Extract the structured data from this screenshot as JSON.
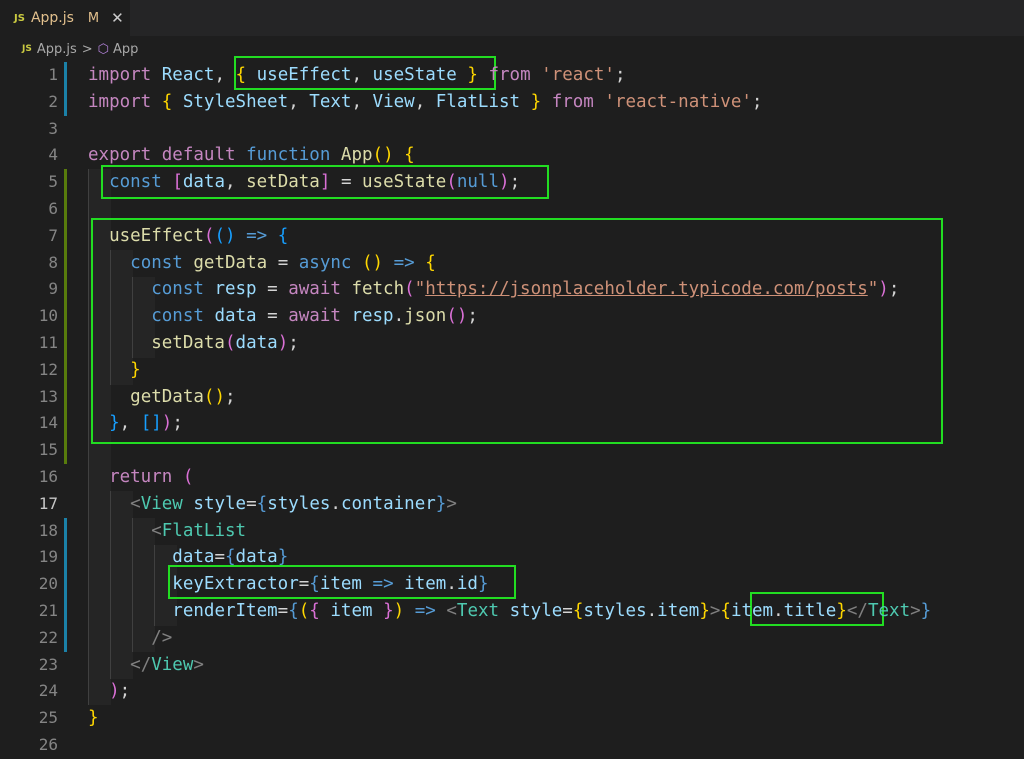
{
  "tab": {
    "icon": "JS",
    "name": "App.js",
    "modified": "M",
    "close": "✕"
  },
  "breadcrumb": {
    "icon": "JS",
    "file": "App.js",
    "separator": ">",
    "symbol": "App"
  },
  "lines": [
    {
      "n": "1",
      "t": [
        [
          "kw",
          "import"
        ],
        [
          "op",
          " "
        ],
        [
          "vr",
          "React"
        ],
        [
          "op",
          ", "
        ],
        [
          "b1",
          "{"
        ],
        [
          "op",
          " "
        ],
        [
          "vr",
          "useEffect"
        ],
        [
          "op",
          ", "
        ],
        [
          "vr",
          "useState"
        ],
        [
          "op",
          " "
        ],
        [
          "b1",
          "}"
        ],
        [
          "op",
          " "
        ],
        [
          "kw",
          "from"
        ],
        [
          "op",
          " "
        ],
        [
          "s",
          "'react'"
        ],
        [
          "op",
          ";"
        ]
      ]
    },
    {
      "n": "2",
      "t": [
        [
          "kw",
          "import"
        ],
        [
          "op",
          " "
        ],
        [
          "b1",
          "{"
        ],
        [
          "op",
          " "
        ],
        [
          "vr",
          "StyleSheet"
        ],
        [
          "op",
          ", "
        ],
        [
          "vr",
          "Text"
        ],
        [
          "op",
          ", "
        ],
        [
          "vr",
          "View"
        ],
        [
          "op",
          ", "
        ],
        [
          "vr",
          "FlatList"
        ],
        [
          "op",
          " "
        ],
        [
          "b1",
          "}"
        ],
        [
          "op",
          " "
        ],
        [
          "kw",
          "from"
        ],
        [
          "op",
          " "
        ],
        [
          "s",
          "'react-native'"
        ],
        [
          "op",
          ";"
        ]
      ]
    },
    {
      "n": "3",
      "t": []
    },
    {
      "n": "4",
      "t": [
        [
          "kw",
          "export"
        ],
        [
          "op",
          " "
        ],
        [
          "kw",
          "default"
        ],
        [
          "op",
          " "
        ],
        [
          "st",
          "function"
        ],
        [
          "op",
          " "
        ],
        [
          "fn",
          "App"
        ],
        [
          "b1",
          "()"
        ],
        [
          "op",
          " "
        ],
        [
          "b1",
          "{"
        ]
      ]
    },
    {
      "n": "5",
      "t": [
        [
          "op",
          "  "
        ],
        [
          "st",
          "const"
        ],
        [
          "op",
          " "
        ],
        [
          "b2",
          "["
        ],
        [
          "vr",
          "data"
        ],
        [
          "op",
          ", "
        ],
        [
          "fn",
          "setData"
        ],
        [
          "b2",
          "]"
        ],
        [
          "op",
          " = "
        ],
        [
          "fn",
          "useState"
        ],
        [
          "b2",
          "("
        ],
        [
          "st",
          "null"
        ],
        [
          "b2",
          ")"
        ],
        [
          "op",
          ";"
        ]
      ]
    },
    {
      "n": "6",
      "t": []
    },
    {
      "n": "7",
      "t": [
        [
          "op",
          "  "
        ],
        [
          "fn",
          "useEffect"
        ],
        [
          "b2",
          "("
        ],
        [
          "b3",
          "()"
        ],
        [
          "op",
          " "
        ],
        [
          "st",
          "=>"
        ],
        [
          "op",
          " "
        ],
        [
          "b3",
          "{"
        ]
      ]
    },
    {
      "n": "8",
      "t": [
        [
          "op",
          "    "
        ],
        [
          "st",
          "const"
        ],
        [
          "op",
          " "
        ],
        [
          "fn",
          "getData"
        ],
        [
          "op",
          " = "
        ],
        [
          "st",
          "async"
        ],
        [
          "op",
          " "
        ],
        [
          "b1",
          "()"
        ],
        [
          "op",
          " "
        ],
        [
          "st",
          "=>"
        ],
        [
          "op",
          " "
        ],
        [
          "b1",
          "{"
        ]
      ]
    },
    {
      "n": "9",
      "t": [
        [
          "op",
          "      "
        ],
        [
          "st",
          "const"
        ],
        [
          "op",
          " "
        ],
        [
          "vr",
          "resp"
        ],
        [
          "op",
          " = "
        ],
        [
          "kw",
          "await"
        ],
        [
          "op",
          " "
        ],
        [
          "fn",
          "fetch"
        ],
        [
          "b2",
          "("
        ],
        [
          "s",
          "\""
        ],
        [
          "url",
          "https://jsonplaceholder.typicode.com/posts"
        ],
        [
          "s",
          "\""
        ],
        [
          "b2",
          ")"
        ],
        [
          "op",
          ";"
        ]
      ]
    },
    {
      "n": "10",
      "t": [
        [
          "op",
          "      "
        ],
        [
          "st",
          "const"
        ],
        [
          "op",
          " "
        ],
        [
          "vr",
          "data"
        ],
        [
          "op",
          " = "
        ],
        [
          "kw",
          "await"
        ],
        [
          "op",
          " "
        ],
        [
          "vr",
          "resp"
        ],
        [
          "op",
          "."
        ],
        [
          "fn",
          "json"
        ],
        [
          "b2",
          "()"
        ],
        [
          "op",
          ";"
        ]
      ]
    },
    {
      "n": "11",
      "t": [
        [
          "op",
          "      "
        ],
        [
          "fn",
          "setData"
        ],
        [
          "b2",
          "("
        ],
        [
          "vr",
          "data"
        ],
        [
          "b2",
          ")"
        ],
        [
          "op",
          ";"
        ]
      ]
    },
    {
      "n": "12",
      "t": [
        [
          "op",
          "    "
        ],
        [
          "b1",
          "}"
        ]
      ]
    },
    {
      "n": "13",
      "t": [
        [
          "op",
          "    "
        ],
        [
          "fn",
          "getData"
        ],
        [
          "b1",
          "()"
        ],
        [
          "op",
          ";"
        ]
      ]
    },
    {
      "n": "14",
      "t": [
        [
          "op",
          "  "
        ],
        [
          "b3",
          "}"
        ],
        [
          "op",
          ", "
        ],
        [
          "b3",
          "[]"
        ],
        [
          "b2",
          ")"
        ],
        [
          "op",
          ";"
        ]
      ]
    },
    {
      "n": "15",
      "t": []
    },
    {
      "n": "16",
      "t": [
        [
          "op",
          "  "
        ],
        [
          "kw",
          "return"
        ],
        [
          "op",
          " "
        ],
        [
          "b2",
          "("
        ]
      ]
    },
    {
      "n": "17",
      "t": [
        [
          "op",
          "    "
        ],
        [
          "tg",
          "<"
        ],
        [
          "cl",
          "View"
        ],
        [
          "op",
          " "
        ],
        [
          "vr",
          "style"
        ],
        [
          "op",
          "="
        ],
        [
          "st",
          "{"
        ],
        [
          "vr",
          "styles"
        ],
        [
          "op",
          "."
        ],
        [
          "vr",
          "container"
        ],
        [
          "st",
          "}"
        ],
        [
          "tg",
          ">"
        ]
      ]
    },
    {
      "n": "18",
      "t": [
        [
          "op",
          "      "
        ],
        [
          "tg",
          "<"
        ],
        [
          "cl",
          "FlatList"
        ]
      ]
    },
    {
      "n": "19",
      "t": [
        [
          "op",
          "        "
        ],
        [
          "vr",
          "data"
        ],
        [
          "op",
          "="
        ],
        [
          "st",
          "{"
        ],
        [
          "vr",
          "data"
        ],
        [
          "st",
          "}"
        ]
      ]
    },
    {
      "n": "20",
      "t": [
        [
          "op",
          "        "
        ],
        [
          "vr",
          "keyExtractor"
        ],
        [
          "op",
          "="
        ],
        [
          "st",
          "{"
        ],
        [
          "vr",
          "item"
        ],
        [
          "op",
          " "
        ],
        [
          "st",
          "=>"
        ],
        [
          "op",
          " "
        ],
        [
          "vr",
          "item"
        ],
        [
          "op",
          "."
        ],
        [
          "vr",
          "id"
        ],
        [
          "st",
          "}"
        ]
      ]
    },
    {
      "n": "21",
      "t": [
        [
          "op",
          "        "
        ],
        [
          "vr",
          "renderItem"
        ],
        [
          "op",
          "="
        ],
        [
          "st",
          "{"
        ],
        [
          "b1",
          "("
        ],
        [
          "b2",
          "{"
        ],
        [
          "op",
          " "
        ],
        [
          "vr",
          "item"
        ],
        [
          "op",
          " "
        ],
        [
          "b2",
          "}"
        ],
        [
          "b1",
          ")"
        ],
        [
          "op",
          " "
        ],
        [
          "st",
          "=>"
        ],
        [
          "op",
          " "
        ],
        [
          "tg",
          "<"
        ],
        [
          "cl",
          "Text"
        ],
        [
          "op",
          " "
        ],
        [
          "vr",
          "style"
        ],
        [
          "op",
          "="
        ],
        [
          "b1",
          "{"
        ],
        [
          "vr",
          "styles"
        ],
        [
          "op",
          "."
        ],
        [
          "vr",
          "item"
        ],
        [
          "b1",
          "}"
        ],
        [
          "tg",
          ">"
        ],
        [
          "b1",
          "{"
        ],
        [
          "vr",
          "item"
        ],
        [
          "op",
          "."
        ],
        [
          "vr",
          "title"
        ],
        [
          "b1",
          "}"
        ],
        [
          "tg",
          "</"
        ],
        [
          "cl",
          "Text"
        ],
        [
          "tg",
          ">"
        ],
        [
          "st",
          "}"
        ]
      ]
    },
    {
      "n": "22",
      "t": [
        [
          "op",
          "      "
        ],
        [
          "tg",
          "/>"
        ]
      ]
    },
    {
      "n": "23",
      "t": [
        [
          "op",
          "    "
        ],
        [
          "tg",
          "</"
        ],
        [
          "cl",
          "View"
        ],
        [
          "tg",
          ">"
        ]
      ]
    },
    {
      "n": "24",
      "t": [
        [
          "op",
          "  "
        ],
        [
          "b2",
          ")"
        ],
        [
          "op",
          ";"
        ]
      ]
    },
    {
      "n": "25",
      "t": [
        [
          "b1",
          "}"
        ]
      ]
    },
    {
      "n": "26",
      "t": []
    }
  ],
  "active_line": "17",
  "colors": {
    "highlight_box": "#22dd22",
    "modified_gutter": "#1b81a8",
    "added_gutter": "#587c0c"
  }
}
